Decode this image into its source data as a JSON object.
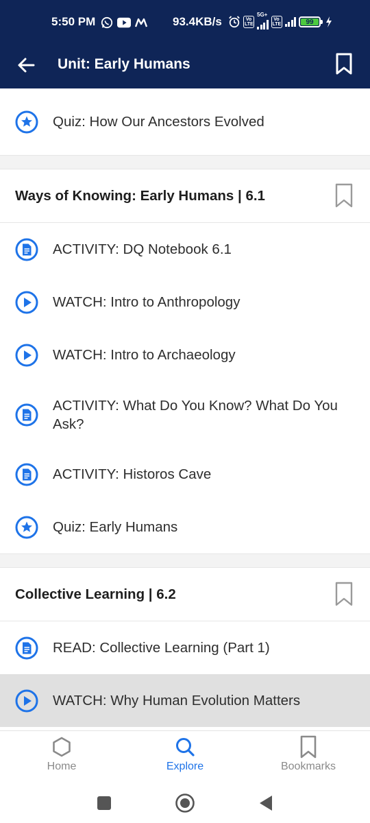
{
  "status_bar": {
    "time": "5:50 PM",
    "net_speed": "93.4KB/s",
    "sim1_badge": "Vo LTE",
    "network_type": "5G+",
    "sim2_badge": "Vo LTE",
    "battery_level": "99",
    "left_icons": [
      "whatsapp-icon",
      "youtube-icon",
      "m-app-icon"
    ],
    "right_icons": [
      "alarm-icon",
      "signal-icon",
      "signal-icon",
      "battery-icon",
      "charging-icon"
    ]
  },
  "app_bar": {
    "title": "Unit: Early Humans",
    "back_icon": "arrow-left-icon",
    "bookmark_icon": "bookmark-outline-icon"
  },
  "list": {
    "top_items": [
      {
        "icon": "star-circle-icon",
        "label": "Quiz: How Our Ancestors Evolved"
      }
    ],
    "sections": [
      {
        "title": "Ways of Knowing: Early Humans | 6.1",
        "items": [
          {
            "icon": "document-circle-icon",
            "label": "ACTIVITY: DQ Notebook 6.1"
          },
          {
            "icon": "play-circle-icon",
            "label": "WATCH: Intro to Anthropology"
          },
          {
            "icon": "play-circle-icon",
            "label": "WATCH: Intro to Archaeology"
          },
          {
            "icon": "document-circle-icon",
            "label": "ACTIVITY: What Do You Know? What Do You Ask?"
          },
          {
            "icon": "document-circle-icon",
            "label": "ACTIVITY: Historos Cave"
          },
          {
            "icon": "star-circle-icon",
            "label": "Quiz: Early Humans"
          }
        ]
      },
      {
        "title": "Collective Learning | 6.2",
        "items": [
          {
            "icon": "document-circle-icon",
            "label": "READ: Collective Learning (Part 1)"
          },
          {
            "icon": "play-circle-icon",
            "label": "WATCH: Why Human Evolution Matters",
            "selected": true
          }
        ]
      }
    ]
  },
  "bottom_nav": {
    "tabs": [
      {
        "label": "Home",
        "icon": "hexagon-icon"
      },
      {
        "label": "Explore",
        "icon": "search-icon",
        "active": true
      },
      {
        "label": "Bookmarks",
        "icon": "bookmark-icon"
      }
    ]
  },
  "system_nav": {
    "buttons": [
      "recents-square-icon",
      "home-circle-icon",
      "back-triangle-icon"
    ]
  },
  "colors": {
    "header_bg": "#0f2557",
    "accent_blue": "#1e73e8",
    "selected_row": "#e0e0e0",
    "battery_green": "#4cc93f"
  }
}
